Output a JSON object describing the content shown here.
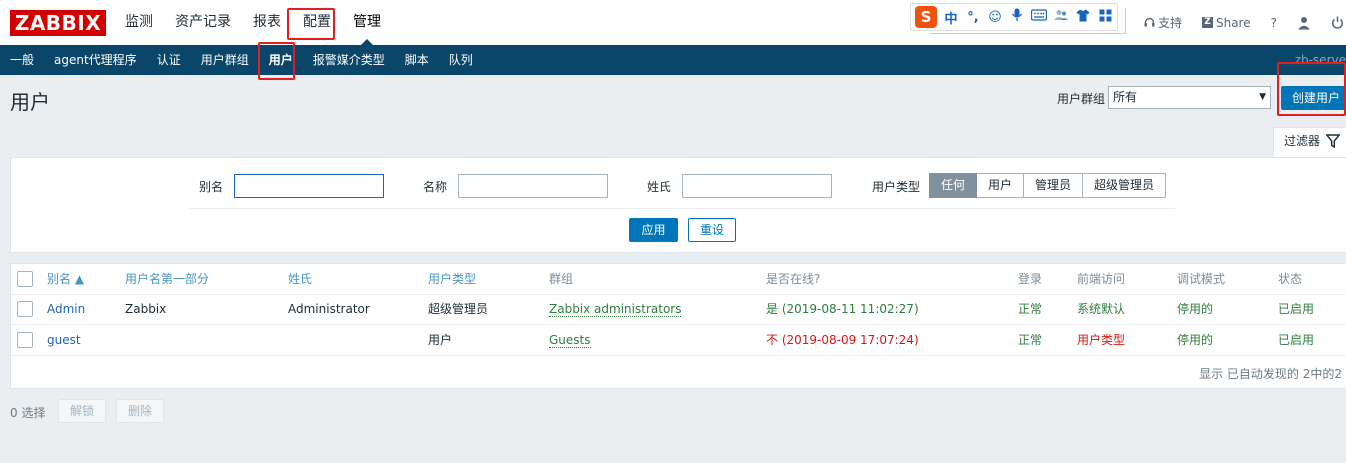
{
  "logo": "ZABBIX",
  "top_menu": [
    {
      "label": "监测"
    },
    {
      "label": "资产记录"
    },
    {
      "label": "报表"
    },
    {
      "label": "配置"
    },
    {
      "label": "管理",
      "selected": true
    }
  ],
  "ime_toolbar": {
    "logo": "S",
    "glyphs": [
      "中",
      "°,",
      "☺",
      "🎤",
      "⌨",
      "👥",
      "👕",
      "⊞"
    ]
  },
  "top_right": {
    "support": "支持",
    "share": "Share",
    "help": "?"
  },
  "sub_menu": [
    {
      "label": "一般"
    },
    {
      "label": "agent代理程序"
    },
    {
      "label": "认证"
    },
    {
      "label": "用户群组"
    },
    {
      "label": "用户",
      "selected": true
    },
    {
      "label": "报警媒介类型"
    },
    {
      "label": "脚本"
    },
    {
      "label": "队列"
    }
  ],
  "server_name": "zb-serve",
  "page_title": "用户",
  "user_group": {
    "label": "用户群组",
    "value": "所有"
  },
  "create_button": "创建用户",
  "filter": {
    "tab_label": "过滤器",
    "alias_label": "别名",
    "alias_value": "",
    "name_label": "名称",
    "name_value": "",
    "surname_label": "姓氏",
    "surname_value": "",
    "type_label": "用户类型",
    "type_options": [
      "任何",
      "用户",
      "管理员",
      "超级管理员"
    ],
    "type_selected": "任何",
    "apply": "应用",
    "reset": "重设"
  },
  "table": {
    "headers": [
      "别名 ▲",
      "用户名第一部分",
      "姓氏",
      "用户类型",
      "群组",
      "是否在线?",
      "登录",
      "前端访问",
      "调试模式",
      "状态"
    ],
    "rows": [
      {
        "alias": "Admin",
        "name": "Zabbix",
        "surname": "Administrator",
        "type": "超级管理员",
        "groups": "Zabbix administrators",
        "online": "是 (2019-08-11 11:02:27)",
        "online_status": "yes",
        "login": "正常",
        "frontend": "系统默认",
        "debug": "停用的",
        "status": "已启用"
      },
      {
        "alias": "guest",
        "name": "",
        "surname": "",
        "type": "用户",
        "groups": "Guests",
        "online": "不 (2019-08-09 17:07:24)",
        "online_status": "no",
        "login": "正常",
        "frontend": "用户类型",
        "debug": "停用的",
        "status": "已启用"
      }
    ],
    "footer": "显示 已自动发现的 2中的2"
  },
  "bottom": {
    "selected": "0 选择",
    "unblock": "解锁",
    "delete": "删除"
  },
  "colors": {
    "brand": "#d40000",
    "nav": "#0a466a",
    "primary": "#0275b8",
    "ok": "#2f7d3d",
    "error": "#d61616",
    "annotation": "#e02020"
  }
}
